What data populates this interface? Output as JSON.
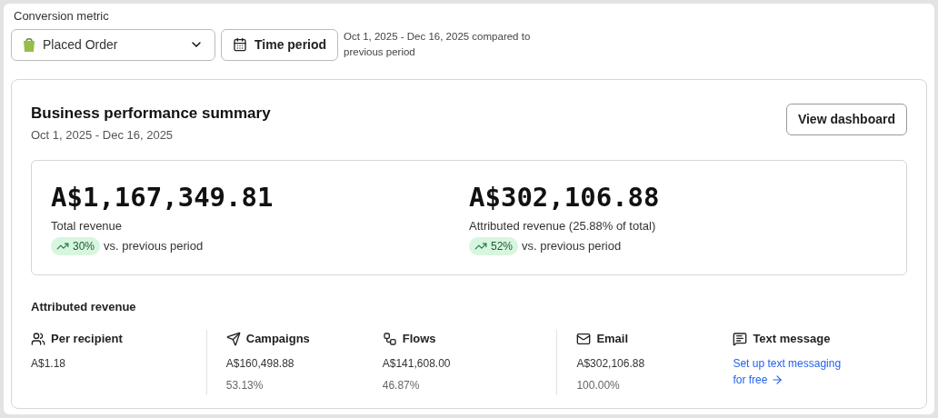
{
  "filter": {
    "label": "Conversion metric",
    "metric": "Placed Order",
    "time_button": "Time period",
    "period_note": "Oct 1, 2025 - Dec 16, 2025 compared to previous period"
  },
  "summary": {
    "title": "Business performance summary",
    "dates": "Oct 1, 2025 - Dec 16, 2025",
    "button": "View dashboard",
    "metrics": [
      {
        "value": "A$1,167,349.81",
        "label": "Total revenue",
        "change": "30%",
        "comparison": "vs. previous period"
      },
      {
        "value": "A$302,106.88",
        "label": "Attributed revenue (25.88% of total)",
        "change": "52%",
        "comparison": "vs. previous period"
      }
    ]
  },
  "attributed": {
    "title": "Attributed revenue",
    "groups": [
      {
        "items": [
          {
            "kind": "recipient",
            "title": "Per recipient",
            "value": "A$1.18"
          }
        ]
      },
      {
        "items": [
          {
            "kind": "campaigns",
            "title": "Campaigns",
            "value": "A$160,498.88",
            "share": "53.13%"
          },
          {
            "kind": "flows",
            "title": "Flows",
            "value": "A$141,608.00",
            "share": "46.87%"
          }
        ]
      },
      {
        "items": [
          {
            "kind": "email",
            "title": "Email",
            "value": "A$302,106.88",
            "share": "100.00%"
          },
          {
            "kind": "sms",
            "title": "Text message",
            "link": "Set up text messaging for free"
          }
        ]
      }
    ]
  }
}
